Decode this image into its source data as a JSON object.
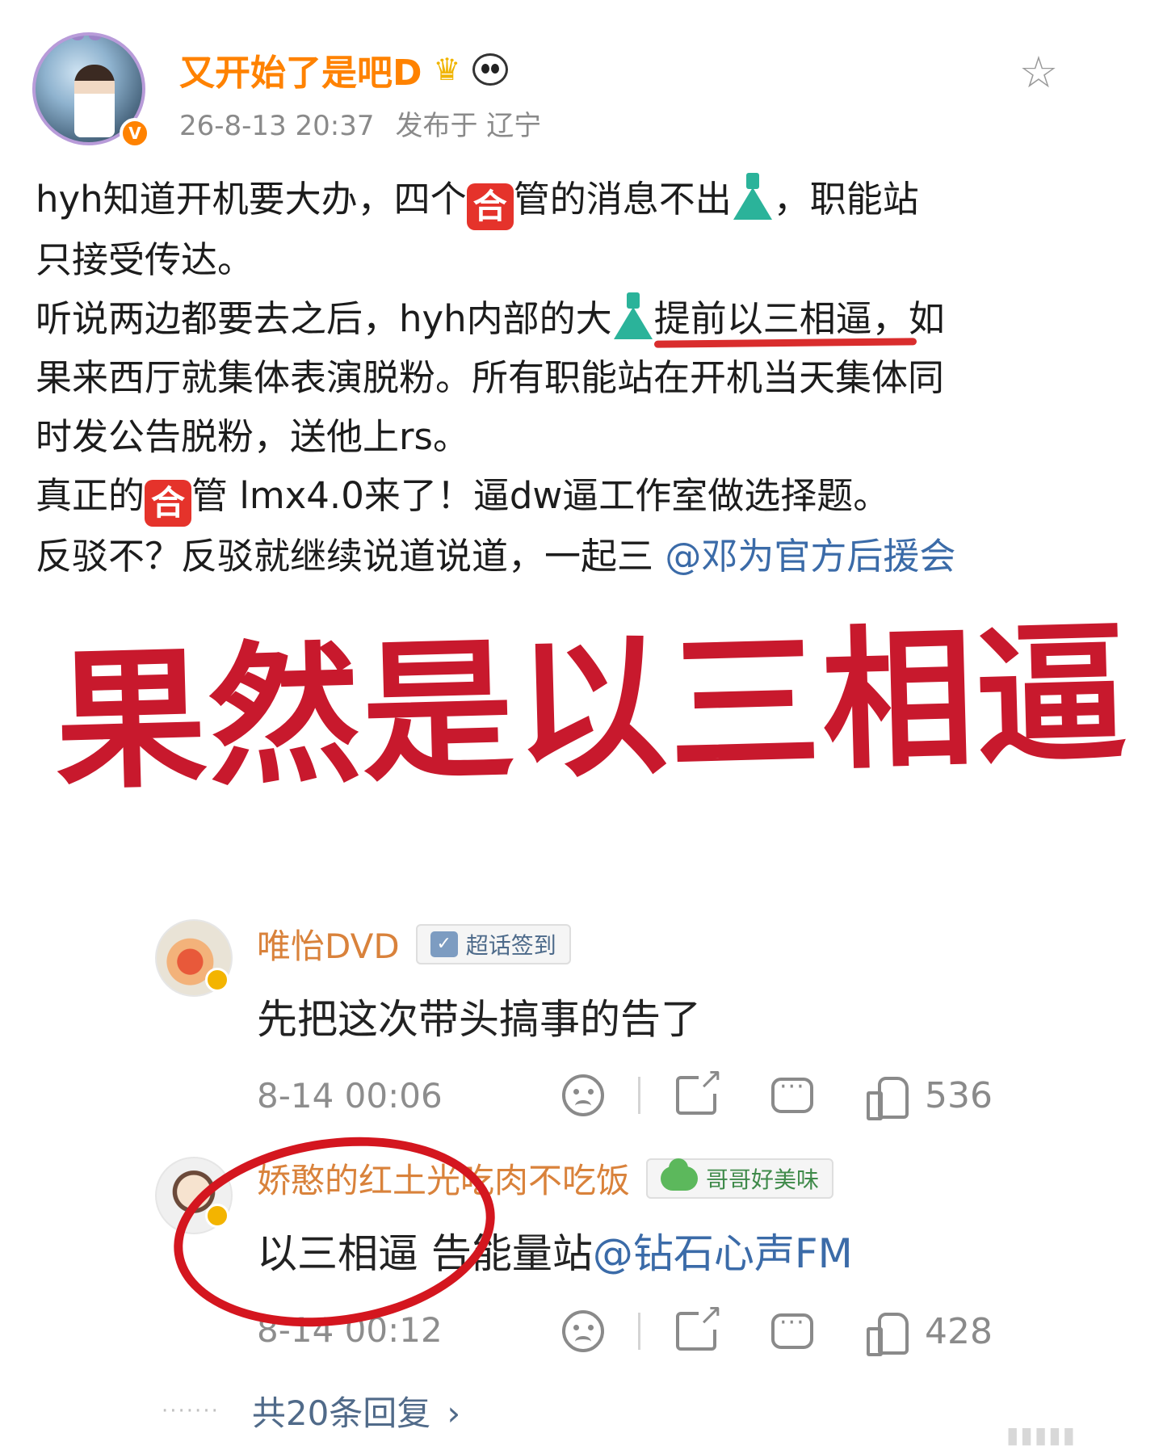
{
  "post": {
    "author": "又开始了是吧D",
    "crown_icon": "crown-icon",
    "panda_icon": "panda-icon",
    "verified_mark": "V",
    "timestamp": "26-8-13 20:37",
    "location": "发布于 辽宁",
    "favorite_icon": "star-icon",
    "body": {
      "line1_a": "hyh知道开机要大办，四个",
      "he_char": "合",
      "line1_b": "管的消息不出",
      "line1_c": "，职能站",
      "line2": "只接受传达。",
      "line3_a": "听说两边都要去之后，hyh内部的大",
      "line3_underlined": "提前以三相逼，",
      "line3_b": "如",
      "line4": "果来西厅就集体表演脱粉。所有职能站在开机当天集体同",
      "line5": "时发公告脱粉，送他上rs。",
      "line6_a": "真正的",
      "line6_b": "管 lmx4.0来了！逼dw逼工作室做选择题。",
      "line7_a": "反驳不？反驳就继续说道说道，一起三 ",
      "line7_mention": "@邓为官方后援会"
    }
  },
  "overlay_caption": "果然是以三相逼",
  "comments": [
    {
      "name": "唯怡DVD",
      "tag": "超话签到",
      "text": "先把这次带头搞事的告了",
      "time": "8-14 00:06",
      "likes": "536"
    },
    {
      "name": "娇憨的红土光吃肉不吃饭",
      "tag": "哥哥好美味",
      "text": "以三相逼 告能量站",
      "mention": "@钻石心声FM",
      "time": "8-14 00:12",
      "likes": "428"
    }
  ],
  "replies_link": "共20条回复",
  "replies_chevron": "›",
  "colors": {
    "author": "#ff8200",
    "caption": "#c8192d",
    "mention": "#3b6ba8",
    "annotation": "#d4161f"
  }
}
